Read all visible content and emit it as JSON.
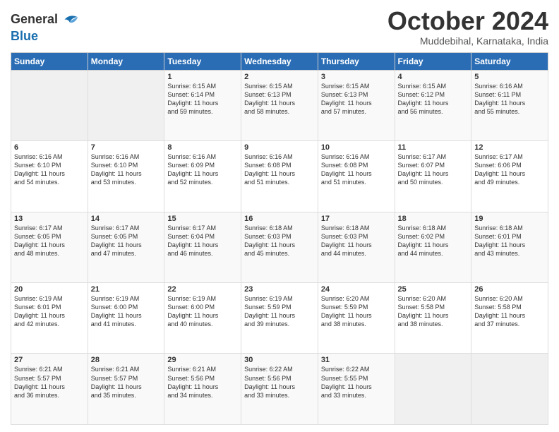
{
  "logo": {
    "line1": "General",
    "line2": "Blue"
  },
  "title": "October 2024",
  "location": "Muddebihal, Karnataka, India",
  "days_header": [
    "Sunday",
    "Monday",
    "Tuesday",
    "Wednesday",
    "Thursday",
    "Friday",
    "Saturday"
  ],
  "weeks": [
    [
      {
        "day": "",
        "info": ""
      },
      {
        "day": "",
        "info": ""
      },
      {
        "day": "1",
        "info": "Sunrise: 6:15 AM\nSunset: 6:14 PM\nDaylight: 11 hours\nand 59 minutes."
      },
      {
        "day": "2",
        "info": "Sunrise: 6:15 AM\nSunset: 6:13 PM\nDaylight: 11 hours\nand 58 minutes."
      },
      {
        "day": "3",
        "info": "Sunrise: 6:15 AM\nSunset: 6:13 PM\nDaylight: 11 hours\nand 57 minutes."
      },
      {
        "day": "4",
        "info": "Sunrise: 6:15 AM\nSunset: 6:12 PM\nDaylight: 11 hours\nand 56 minutes."
      },
      {
        "day": "5",
        "info": "Sunrise: 6:16 AM\nSunset: 6:11 PM\nDaylight: 11 hours\nand 55 minutes."
      }
    ],
    [
      {
        "day": "6",
        "info": "Sunrise: 6:16 AM\nSunset: 6:10 PM\nDaylight: 11 hours\nand 54 minutes."
      },
      {
        "day": "7",
        "info": "Sunrise: 6:16 AM\nSunset: 6:10 PM\nDaylight: 11 hours\nand 53 minutes."
      },
      {
        "day": "8",
        "info": "Sunrise: 6:16 AM\nSunset: 6:09 PM\nDaylight: 11 hours\nand 52 minutes."
      },
      {
        "day": "9",
        "info": "Sunrise: 6:16 AM\nSunset: 6:08 PM\nDaylight: 11 hours\nand 51 minutes."
      },
      {
        "day": "10",
        "info": "Sunrise: 6:16 AM\nSunset: 6:08 PM\nDaylight: 11 hours\nand 51 minutes."
      },
      {
        "day": "11",
        "info": "Sunrise: 6:17 AM\nSunset: 6:07 PM\nDaylight: 11 hours\nand 50 minutes."
      },
      {
        "day": "12",
        "info": "Sunrise: 6:17 AM\nSunset: 6:06 PM\nDaylight: 11 hours\nand 49 minutes."
      }
    ],
    [
      {
        "day": "13",
        "info": "Sunrise: 6:17 AM\nSunset: 6:05 PM\nDaylight: 11 hours\nand 48 minutes."
      },
      {
        "day": "14",
        "info": "Sunrise: 6:17 AM\nSunset: 6:05 PM\nDaylight: 11 hours\nand 47 minutes."
      },
      {
        "day": "15",
        "info": "Sunrise: 6:17 AM\nSunset: 6:04 PM\nDaylight: 11 hours\nand 46 minutes."
      },
      {
        "day": "16",
        "info": "Sunrise: 6:18 AM\nSunset: 6:03 PM\nDaylight: 11 hours\nand 45 minutes."
      },
      {
        "day": "17",
        "info": "Sunrise: 6:18 AM\nSunset: 6:03 PM\nDaylight: 11 hours\nand 44 minutes."
      },
      {
        "day": "18",
        "info": "Sunrise: 6:18 AM\nSunset: 6:02 PM\nDaylight: 11 hours\nand 44 minutes."
      },
      {
        "day": "19",
        "info": "Sunrise: 6:18 AM\nSunset: 6:01 PM\nDaylight: 11 hours\nand 43 minutes."
      }
    ],
    [
      {
        "day": "20",
        "info": "Sunrise: 6:19 AM\nSunset: 6:01 PM\nDaylight: 11 hours\nand 42 minutes."
      },
      {
        "day": "21",
        "info": "Sunrise: 6:19 AM\nSunset: 6:00 PM\nDaylight: 11 hours\nand 41 minutes."
      },
      {
        "day": "22",
        "info": "Sunrise: 6:19 AM\nSunset: 6:00 PM\nDaylight: 11 hours\nand 40 minutes."
      },
      {
        "day": "23",
        "info": "Sunrise: 6:19 AM\nSunset: 5:59 PM\nDaylight: 11 hours\nand 39 minutes."
      },
      {
        "day": "24",
        "info": "Sunrise: 6:20 AM\nSunset: 5:59 PM\nDaylight: 11 hours\nand 38 minutes."
      },
      {
        "day": "25",
        "info": "Sunrise: 6:20 AM\nSunset: 5:58 PM\nDaylight: 11 hours\nand 38 minutes."
      },
      {
        "day": "26",
        "info": "Sunrise: 6:20 AM\nSunset: 5:58 PM\nDaylight: 11 hours\nand 37 minutes."
      }
    ],
    [
      {
        "day": "27",
        "info": "Sunrise: 6:21 AM\nSunset: 5:57 PM\nDaylight: 11 hours\nand 36 minutes."
      },
      {
        "day": "28",
        "info": "Sunrise: 6:21 AM\nSunset: 5:57 PM\nDaylight: 11 hours\nand 35 minutes."
      },
      {
        "day": "29",
        "info": "Sunrise: 6:21 AM\nSunset: 5:56 PM\nDaylight: 11 hours\nand 34 minutes."
      },
      {
        "day": "30",
        "info": "Sunrise: 6:22 AM\nSunset: 5:56 PM\nDaylight: 11 hours\nand 33 minutes."
      },
      {
        "day": "31",
        "info": "Sunrise: 6:22 AM\nSunset: 5:55 PM\nDaylight: 11 hours\nand 33 minutes."
      },
      {
        "day": "",
        "info": ""
      },
      {
        "day": "",
        "info": ""
      }
    ]
  ]
}
